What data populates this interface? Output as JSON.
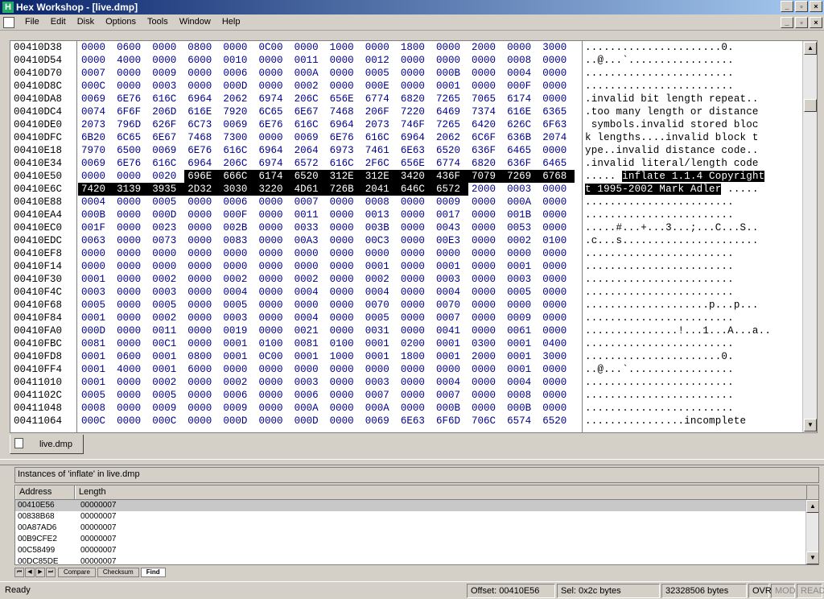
{
  "window": {
    "title": "Hex Workshop - [live.dmp]",
    "min_glyph": "_",
    "max_glyph": "▫",
    "close_glyph": "×"
  },
  "menu": {
    "items": [
      "File",
      "Edit",
      "Disk",
      "Options",
      "Tools",
      "Window",
      "Help"
    ]
  },
  "hex": {
    "rows": [
      {
        "addr": "00410D38",
        "hex": [
          "0000",
          "0600",
          "0000",
          "0800",
          "0000",
          "0C00",
          "0000",
          "1000",
          "0000",
          "1800",
          "0000",
          "2000",
          "0000",
          "3000"
        ],
        "asc": "......................0."
      },
      {
        "addr": "00410D54",
        "hex": [
          "0000",
          "4000",
          "0000",
          "6000",
          "0010",
          "0000",
          "0011",
          "0000",
          "0012",
          "0000",
          "0000",
          "0000",
          "0008",
          "0000"
        ],
        "asc": "..@...`................."
      },
      {
        "addr": "00410D70",
        "hex": [
          "0007",
          "0000",
          "0009",
          "0000",
          "0006",
          "0000",
          "000A",
          "0000",
          "0005",
          "0000",
          "000B",
          "0000",
          "0004",
          "0000"
        ],
        "asc": "........................"
      },
      {
        "addr": "00410D8C",
        "hex": [
          "000C",
          "0000",
          "0003",
          "0000",
          "000D",
          "0000",
          "0002",
          "0000",
          "000E",
          "0000",
          "0001",
          "0000",
          "000F",
          "0000"
        ],
        "asc": "........................"
      },
      {
        "addr": "00410DA8",
        "hex": [
          "0069",
          "6E76",
          "616C",
          "6964",
          "2062",
          "6974",
          "206C",
          "656E",
          "6774",
          "6820",
          "7265",
          "7065",
          "6174",
          "0000"
        ],
        "asc": ".invalid bit length repeat.."
      },
      {
        "addr": "00410DC4",
        "hex": [
          "0074",
          "6F6F",
          "206D",
          "616E",
          "7920",
          "6C65",
          "6E67",
          "7468",
          "206F",
          "7220",
          "6469",
          "7374",
          "616E",
          "6365"
        ],
        "asc": ".too many length or distance"
      },
      {
        "addr": "00410DE0",
        "hex": [
          "2073",
          "796D",
          "626F",
          "6C73",
          "0069",
          "6E76",
          "616C",
          "6964",
          "2073",
          "746F",
          "7265",
          "6420",
          "626C",
          "6F63"
        ],
        "asc": " symbols.invalid stored bloc"
      },
      {
        "addr": "00410DFC",
        "hex": [
          "6B20",
          "6C65",
          "6E67",
          "7468",
          "7300",
          "0000",
          "0069",
          "6E76",
          "616C",
          "6964",
          "2062",
          "6C6F",
          "636B",
          "2074"
        ],
        "asc": "k lengths....invalid block t"
      },
      {
        "addr": "00410E18",
        "hex": [
          "7970",
          "6500",
          "0069",
          "6E76",
          "616C",
          "6964",
          "2064",
          "6973",
          "7461",
          "6E63",
          "6520",
          "636F",
          "6465",
          "0000"
        ],
        "asc": "ype..invalid distance code.."
      },
      {
        "addr": "00410E34",
        "hex": [
          "0069",
          "6E76",
          "616C",
          "6964",
          "206C",
          "6974",
          "6572",
          "616C",
          "2F6C",
          "656E",
          "6774",
          "6820",
          "636F",
          "6465"
        ],
        "asc": ".invalid literal/length code"
      },
      {
        "addr": "00410E50",
        "hex": [
          "0000",
          "0000",
          "0020",
          "696E",
          "666C",
          "6174",
          "6520",
          "312E",
          "312E",
          "3420",
          "436F",
          "7079",
          "7269",
          "6768"
        ],
        "sel_from": 3,
        "sel_to": 13,
        "asc": "..... ",
        "asc_sel": "inflate 1.1.4 Copyright"
      },
      {
        "addr": "00410E6C",
        "hex": [
          "7420",
          "3139",
          "3935",
          "2D32",
          "3030",
          "3220",
          "4D61",
          "726B",
          "2041",
          "646C",
          "6572",
          "2000",
          "0003",
          "0000"
        ],
        "sel_from": 0,
        "sel_to": 10,
        "asc": "",
        "asc_sel": "t 1995-2002 Mark Adler",
        "asc_after": " ....."
      },
      {
        "addr": "00410E88",
        "hex": [
          "0004",
          "0000",
          "0005",
          "0000",
          "0006",
          "0000",
          "0007",
          "0000",
          "0008",
          "0000",
          "0009",
          "0000",
          "000A",
          "0000"
        ],
        "asc": "........................"
      },
      {
        "addr": "00410EA4",
        "hex": [
          "000B",
          "0000",
          "000D",
          "0000",
          "000F",
          "0000",
          "0011",
          "0000",
          "0013",
          "0000",
          "0017",
          "0000",
          "001B",
          "0000"
        ],
        "asc": "........................"
      },
      {
        "addr": "00410EC0",
        "hex": [
          "001F",
          "0000",
          "0023",
          "0000",
          "002B",
          "0000",
          "0033",
          "0000",
          "003B",
          "0000",
          "0043",
          "0000",
          "0053",
          "0000"
        ],
        "asc": ".....#...+...3...;...C...S.."
      },
      {
        "addr": "00410EDC",
        "hex": [
          "0063",
          "0000",
          "0073",
          "0000",
          "0083",
          "0000",
          "00A3",
          "0000",
          "00C3",
          "0000",
          "00E3",
          "0000",
          "0002",
          "0100"
        ],
        "asc": ".c...s......................"
      },
      {
        "addr": "00410EF8",
        "hex": [
          "0000",
          "0000",
          "0000",
          "0000",
          "0000",
          "0000",
          "0000",
          "0000",
          "0000",
          "0000",
          "0000",
          "0000",
          "0000",
          "0000"
        ],
        "asc": "........................"
      },
      {
        "addr": "00410F14",
        "hex": [
          "0000",
          "0000",
          "0000",
          "0000",
          "0000",
          "0000",
          "0000",
          "0000",
          "0001",
          "0000",
          "0001",
          "0000",
          "0001",
          "0000"
        ],
        "asc": "........................"
      },
      {
        "addr": "00410F30",
        "hex": [
          "0001",
          "0000",
          "0002",
          "0000",
          "0002",
          "0000",
          "0002",
          "0000",
          "0002",
          "0000",
          "0003",
          "0000",
          "0003",
          "0000"
        ],
        "asc": "........................"
      },
      {
        "addr": "00410F4C",
        "hex": [
          "0003",
          "0000",
          "0003",
          "0000",
          "0004",
          "0000",
          "0004",
          "0000",
          "0004",
          "0000",
          "0004",
          "0000",
          "0005",
          "0000"
        ],
        "asc": "........................"
      },
      {
        "addr": "00410F68",
        "hex": [
          "0005",
          "0000",
          "0005",
          "0000",
          "0005",
          "0000",
          "0000",
          "0000",
          "0070",
          "0000",
          "0070",
          "0000",
          "0000",
          "0000"
        ],
        "asc": "....................p...p..."
      },
      {
        "addr": "00410F84",
        "hex": [
          "0001",
          "0000",
          "0002",
          "0000",
          "0003",
          "0000",
          "0004",
          "0000",
          "0005",
          "0000",
          "0007",
          "0000",
          "0009",
          "0000"
        ],
        "asc": "........................"
      },
      {
        "addr": "00410FA0",
        "hex": [
          "000D",
          "0000",
          "0011",
          "0000",
          "0019",
          "0000",
          "0021",
          "0000",
          "0031",
          "0000",
          "0041",
          "0000",
          "0061",
          "0000"
        ],
        "asc": "...............!...1...A...a.."
      },
      {
        "addr": "00410FBC",
        "hex": [
          "0081",
          "0000",
          "00C1",
          "0000",
          "0001",
          "0100",
          "0081",
          "0100",
          "0001",
          "0200",
          "0001",
          "0300",
          "0001",
          "0400"
        ],
        "asc": "........................"
      },
      {
        "addr": "00410FD8",
        "hex": [
          "0001",
          "0600",
          "0001",
          "0800",
          "0001",
          "0C00",
          "0001",
          "1000",
          "0001",
          "1800",
          "0001",
          "2000",
          "0001",
          "3000"
        ],
        "asc": "......................0."
      },
      {
        "addr": "00410FF4",
        "hex": [
          "0001",
          "4000",
          "0001",
          "6000",
          "0000",
          "0000",
          "0000",
          "0000",
          "0000",
          "0000",
          "0000",
          "0000",
          "0001",
          "0000"
        ],
        "asc": "..@...`................."
      },
      {
        "addr": "00411010",
        "hex": [
          "0001",
          "0000",
          "0002",
          "0000",
          "0002",
          "0000",
          "0003",
          "0000",
          "0003",
          "0000",
          "0004",
          "0000",
          "0004",
          "0000"
        ],
        "asc": "........................"
      },
      {
        "addr": "0041102C",
        "hex": [
          "0005",
          "0000",
          "0005",
          "0000",
          "0006",
          "0000",
          "0006",
          "0000",
          "0007",
          "0000",
          "0007",
          "0000",
          "0008",
          "0000"
        ],
        "asc": "........................"
      },
      {
        "addr": "00411048",
        "hex": [
          "0008",
          "0000",
          "0009",
          "0000",
          "0009",
          "0000",
          "000A",
          "0000",
          "000A",
          "0000",
          "000B",
          "0000",
          "000B",
          "0000"
        ],
        "asc": "........................"
      },
      {
        "addr": "00411064",
        "hex": [
          "000C",
          "0000",
          "000C",
          "0000",
          "000D",
          "0000",
          "000D",
          "0000",
          "0069",
          "6E63",
          "6F6D",
          "706C",
          "6574",
          "6520"
        ],
        "asc": "................incomplete "
      }
    ]
  },
  "doc_tab": {
    "label": "live.dmp"
  },
  "find": {
    "title": "Instances of 'inflate' in live.dmp",
    "columns": [
      "Address",
      "Length"
    ],
    "rows": [
      {
        "address": "00410E56",
        "length": "00000007"
      },
      {
        "address": "00838B68",
        "length": "00000007"
      },
      {
        "address": "00A87AD6",
        "length": "00000007"
      },
      {
        "address": "00B9CFE2",
        "length": "00000007"
      },
      {
        "address": "00C58499",
        "length": "00000007"
      },
      {
        "address": "00DC85DE",
        "length": "00000007"
      }
    ]
  },
  "bottom_tabs": [
    "Compare",
    "Checksum",
    "Find"
  ],
  "status": {
    "ready": "Ready",
    "offset": "Offset: 00410E56",
    "sel": "Sel: 0x2c bytes",
    "size": "32328506 bytes",
    "ovr": "OVR",
    "mod": "MOD",
    "read": "READ"
  }
}
